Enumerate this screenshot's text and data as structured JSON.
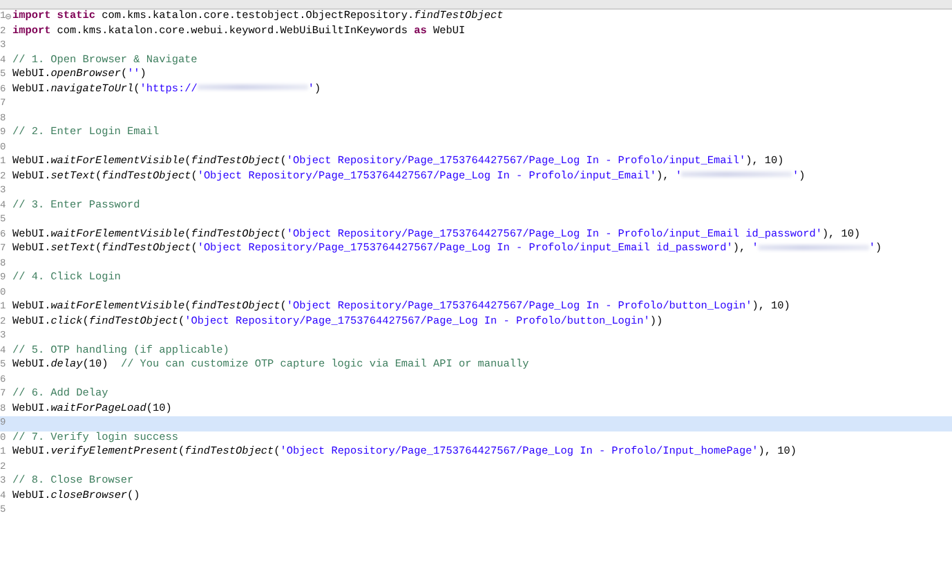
{
  "editor": {
    "lines": [
      {
        "number": "1",
        "fold": true,
        "highlighted": false,
        "tokens": [
          {
            "kind": "kw",
            "text": "import static"
          },
          {
            "kind": "plain",
            "text": " com.kms.katalon.core.testobject.ObjectRepository."
          },
          {
            "kind": "method",
            "text": "findTestObject"
          }
        ]
      },
      {
        "number": "2",
        "fold": false,
        "highlighted": false,
        "tokens": [
          {
            "kind": "kw",
            "text": "import"
          },
          {
            "kind": "plain",
            "text": " com.kms.katalon.core.webui.keyword.WebUiBuiltInKeywords "
          },
          {
            "kind": "kw",
            "text": "as"
          },
          {
            "kind": "plain",
            "text": " WebUI"
          }
        ]
      },
      {
        "number": "3",
        "fold": false,
        "highlighted": false
      },
      {
        "number": "4",
        "fold": false,
        "highlighted": false,
        "tokens": [
          {
            "kind": "comment",
            "text": "// 1. Open Browser & Navigate"
          }
        ]
      },
      {
        "number": "5",
        "fold": false,
        "highlighted": false,
        "tokens": [
          {
            "kind": "plain",
            "text": "WebUI."
          },
          {
            "kind": "method",
            "text": "openBrowser"
          },
          {
            "kind": "plain",
            "text": "("
          },
          {
            "kind": "str",
            "text": "''"
          },
          {
            "kind": "plain",
            "text": ")"
          }
        ]
      },
      {
        "number": "6",
        "fold": false,
        "highlighted": false,
        "tokens": [
          {
            "kind": "plain",
            "text": "WebUI."
          },
          {
            "kind": "method",
            "text": "navigateToUrl"
          },
          {
            "kind": "plain",
            "text": "("
          },
          {
            "kind": "str",
            "text": "'https://"
          },
          {
            "kind": "blur"
          },
          {
            "kind": "str",
            "text": "'"
          },
          {
            "kind": "plain",
            "text": ")"
          }
        ]
      },
      {
        "number": "7",
        "fold": false,
        "highlighted": false
      },
      {
        "number": "8",
        "fold": false,
        "highlighted": false
      },
      {
        "number": "9",
        "fold": false,
        "highlighted": false,
        "tokens": [
          {
            "kind": "comment",
            "text": "// 2. Enter Login Email"
          }
        ]
      },
      {
        "number": "0",
        "fold": false,
        "highlighted": false
      },
      {
        "number": "1",
        "fold": false,
        "highlighted": false,
        "tokens": [
          {
            "kind": "plain",
            "text": "WebUI."
          },
          {
            "kind": "method",
            "text": "waitForElementVisible"
          },
          {
            "kind": "plain",
            "text": "("
          },
          {
            "kind": "method",
            "text": "findTestObject"
          },
          {
            "kind": "plain",
            "text": "("
          },
          {
            "kind": "str",
            "text": "'Object Repository/Page_1753764427567/Page_Log In - Profolo/input_Email'"
          },
          {
            "kind": "plain",
            "text": "), 10)"
          }
        ]
      },
      {
        "number": "2",
        "fold": false,
        "highlighted": false,
        "tokens": [
          {
            "kind": "plain",
            "text": "WebUI."
          },
          {
            "kind": "method",
            "text": "setText"
          },
          {
            "kind": "plain",
            "text": "("
          },
          {
            "kind": "method",
            "text": "findTestObject"
          },
          {
            "kind": "plain",
            "text": "("
          },
          {
            "kind": "str",
            "text": "'Object Repository/Page_1753764427567/Page_Log In - Profolo/input_Email'"
          },
          {
            "kind": "plain",
            "text": "), "
          },
          {
            "kind": "str",
            "text": "'"
          },
          {
            "kind": "blur"
          },
          {
            "kind": "str",
            "text": "'"
          },
          {
            "kind": "plain",
            "text": ")"
          }
        ]
      },
      {
        "number": "3",
        "fold": false,
        "highlighted": false
      },
      {
        "number": "4",
        "fold": false,
        "highlighted": false,
        "tokens": [
          {
            "kind": "comment",
            "text": "// 3. Enter Password"
          }
        ]
      },
      {
        "number": "5",
        "fold": false,
        "highlighted": false
      },
      {
        "number": "6",
        "fold": false,
        "highlighted": false,
        "tokens": [
          {
            "kind": "plain",
            "text": "WebUI."
          },
          {
            "kind": "method",
            "text": "waitForElementVisible"
          },
          {
            "kind": "plain",
            "text": "("
          },
          {
            "kind": "method",
            "text": "findTestObject"
          },
          {
            "kind": "plain",
            "text": "("
          },
          {
            "kind": "str",
            "text": "'Object Repository/Page_1753764427567/Page_Log In - Profolo/input_Email id_password'"
          },
          {
            "kind": "plain",
            "text": "), 10)"
          }
        ]
      },
      {
        "number": "7",
        "fold": false,
        "highlighted": false,
        "tokens": [
          {
            "kind": "plain",
            "text": "WebUI."
          },
          {
            "kind": "method",
            "text": "setText"
          },
          {
            "kind": "plain",
            "text": "("
          },
          {
            "kind": "method",
            "text": "findTestObject"
          },
          {
            "kind": "plain",
            "text": "("
          },
          {
            "kind": "str",
            "text": "'Object Repository/Page_1753764427567/Page_Log In - Profolo/input_Email id_password'"
          },
          {
            "kind": "plain",
            "text": "), "
          },
          {
            "kind": "str",
            "text": "'"
          },
          {
            "kind": "blur"
          },
          {
            "kind": "str",
            "text": "'"
          },
          {
            "kind": "plain",
            "text": ")"
          }
        ]
      },
      {
        "number": "8",
        "fold": false,
        "highlighted": false
      },
      {
        "number": "9",
        "fold": false,
        "highlighted": false,
        "tokens": [
          {
            "kind": "comment",
            "text": "// 4. Click Login"
          }
        ]
      },
      {
        "number": "0",
        "fold": false,
        "highlighted": false
      },
      {
        "number": "1",
        "fold": false,
        "highlighted": false,
        "tokens": [
          {
            "kind": "plain",
            "text": "WebUI."
          },
          {
            "kind": "method",
            "text": "waitForElementVisible"
          },
          {
            "kind": "plain",
            "text": "("
          },
          {
            "kind": "method",
            "text": "findTestObject"
          },
          {
            "kind": "plain",
            "text": "("
          },
          {
            "kind": "str",
            "text": "'Object Repository/Page_1753764427567/Page_Log In - Profolo/button_Login'"
          },
          {
            "kind": "plain",
            "text": "), 10)"
          }
        ]
      },
      {
        "number": "2",
        "fold": false,
        "highlighted": false,
        "tokens": [
          {
            "kind": "plain",
            "text": "WebUI."
          },
          {
            "kind": "method",
            "text": "click"
          },
          {
            "kind": "plain",
            "text": "("
          },
          {
            "kind": "method",
            "text": "findTestObject"
          },
          {
            "kind": "plain",
            "text": "("
          },
          {
            "kind": "str",
            "text": "'Object Repository/Page_1753764427567/Page_Log In - Profolo/button_Login'"
          },
          {
            "kind": "plain",
            "text": "))"
          }
        ]
      },
      {
        "number": "3",
        "fold": false,
        "highlighted": false
      },
      {
        "number": "4",
        "fold": false,
        "highlighted": false,
        "tokens": [
          {
            "kind": "comment",
            "text": "// 5. OTP handling (if applicable)"
          }
        ]
      },
      {
        "number": "5",
        "fold": false,
        "highlighted": false,
        "tokens": [
          {
            "kind": "plain",
            "text": "WebUI."
          },
          {
            "kind": "method",
            "text": "delay"
          },
          {
            "kind": "plain",
            "text": "(10)  "
          },
          {
            "kind": "comment",
            "text": "// You can customize OTP capture logic via Email API or manually"
          }
        ]
      },
      {
        "number": "6",
        "fold": false,
        "highlighted": false
      },
      {
        "number": "7",
        "fold": false,
        "highlighted": false,
        "tokens": [
          {
            "kind": "comment",
            "text": "// 6. Add Delay"
          }
        ]
      },
      {
        "number": "8",
        "fold": false,
        "highlighted": false,
        "tokens": [
          {
            "kind": "plain",
            "text": "WebUI."
          },
          {
            "kind": "method",
            "text": "waitForPageLoad"
          },
          {
            "kind": "plain",
            "text": "(10)"
          }
        ]
      },
      {
        "number": "9",
        "fold": false,
        "highlighted": true
      },
      {
        "number": "0",
        "fold": false,
        "highlighted": false,
        "tokens": [
          {
            "kind": "comment",
            "text": "// 7. Verify login success"
          }
        ]
      },
      {
        "number": "1",
        "fold": false,
        "highlighted": false,
        "tokens": [
          {
            "kind": "plain",
            "text": "WebUI."
          },
          {
            "kind": "method",
            "text": "verifyElementPresent"
          },
          {
            "kind": "plain",
            "text": "("
          },
          {
            "kind": "method",
            "text": "findTestObject"
          },
          {
            "kind": "plain",
            "text": "("
          },
          {
            "kind": "str",
            "text": "'Object Repository/Page_1753764427567/Page_Log In - Profolo/Input_homePage'"
          },
          {
            "kind": "plain",
            "text": "), 10)"
          }
        ]
      },
      {
        "number": "2",
        "fold": false,
        "highlighted": false
      },
      {
        "number": "3",
        "fold": false,
        "highlighted": false,
        "tokens": [
          {
            "kind": "comment",
            "text": "// 8. Close Browser"
          }
        ]
      },
      {
        "number": "4",
        "fold": false,
        "highlighted": false,
        "tokens": [
          {
            "kind": "plain",
            "text": "WebUI."
          },
          {
            "kind": "method",
            "text": "closeBrowser"
          },
          {
            "kind": "plain",
            "text": "()"
          }
        ]
      },
      {
        "number": "5",
        "fold": false,
        "highlighted": false
      }
    ]
  }
}
